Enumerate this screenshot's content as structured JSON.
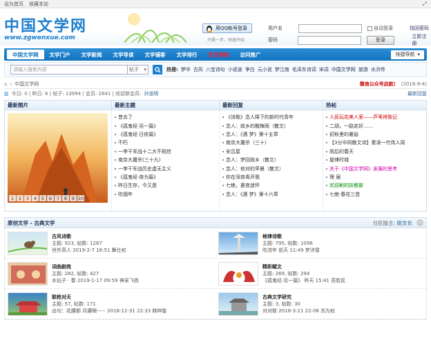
{
  "topbar": {
    "set_home": "设为首页",
    "favorite": "收藏本站"
  },
  "logo": {
    "cn": "中国文学网",
    "url": "www.zgwenxue.com"
  },
  "qq": {
    "login_label": "用QQ帐号登录",
    "sub": "只需一步，快速开始"
  },
  "login": {
    "user_label": "用户名",
    "user_value": "",
    "pass_label": "密码",
    "pass_value": "",
    "auto_login": "自动登录",
    "login_btn": "登录",
    "find_pwd": "找回密码",
    "register": "立即注册"
  },
  "nav": {
    "items": [
      "中国文学网",
      "文学门户",
      "文学新闻",
      "文学导读",
      "文学铺客",
      "文学排行",
      "官方网络",
      "访问推广"
    ],
    "quick_nav": "快捷导航"
  },
  "search": {
    "placeholder": "请输入搜索内容",
    "type": "帖子",
    "hot_label": "热搜:",
    "hot_words": [
      "梦中",
      "古风",
      "八宝诗句",
      "小说途",
      "李白",
      "元小说",
      "梦江南",
      "毛泽东诗词",
      "宋词",
      "中国文学网",
      "旅游",
      "水浒传"
    ]
  },
  "crumb": {
    "home": "中国文学网",
    "notice": "微信公众号启航！",
    "date": "(2016-9-4)"
  },
  "stats": {
    "text": "今日: 0 | 昨日: 6 | 帖子: 13994 | 会员: 2841 | 欢迎新会员:",
    "new_member": "孙道明",
    "latest": "最新回复"
  },
  "panel": {
    "heads": [
      "最新图片",
      "最新主题",
      "最新回复",
      "热帖"
    ],
    "slider_nums": [
      "1",
      "2",
      "3",
      "4",
      "5",
      "6",
      "7",
      "8",
      "9",
      "10"
    ],
    "new_topics": [
      "昔去了",
      "《孤鬼经·另一篇》",
      "《孤鬼经·日依篇》",
      "不朽",
      "一李干军战十二大不相信",
      "南京大屠杀(三十九)",
      "一李干军战历史虚无主义",
      "《孤鬼经·夜为篇》",
      "昨日生存，今又是",
      "吹烟年"
    ],
    "new_replies": [
      "《诗歌》念人降下的新时代青年",
      "念人：故乡的醒梅雨（散文）",
      "念人：《遇 梦》第十五章",
      "南京大屠杀（三十）",
      "安吕屋",
      "念人：梦回故乡（散文）",
      "念人：依对的早晨（散文）",
      "你在深夜毒开我",
      "七绝，夏夜迷怀",
      "念人：《遇 梦》第十六章"
    ],
    "hot": [
      {
        "t": "人民玩花美人室——芦苇将歌记",
        "c": "red"
      },
      {
        "t": "二胡，一路走好……",
        "c": ""
      },
      {
        "t": "初秋里的邂逅",
        "c": ""
      },
      {
        "t": "【3分中同散文诗】重读一代伟人周",
        "c": ""
      },
      {
        "t": "雨后的春天",
        "c": ""
      },
      {
        "t": "旋律时城",
        "c": ""
      },
      {
        "t": "关于《中国文学网》发展的思考",
        "c": "pink"
      },
      {
        "t": "理 届",
        "c": ""
      },
      {
        "t": "欢迎刷的扶都部",
        "c": "green"
      },
      {
        "t": "七绝·春花三首",
        "c": ""
      }
    ]
  },
  "section": {
    "title": "原创文学 - 古典文学",
    "moderator_label": "分区版主:",
    "moderator": "姚文长",
    "toggle": "−"
  },
  "forums": [
    {
      "name": "古风诗歌",
      "stats": "主题: 923, 帖数: 1287",
      "last": "世外高人 2019-2-7 16:51 舞仕权",
      "thumb": "bird"
    },
    {
      "name": "格律诗歌",
      "stats": "主题: 795, 帖数: 1096",
      "last": "吹流年 前天 11:49 梦涉雷",
      "thumb": "tower"
    },
    {
      "name": "词曲剧苑",
      "stats": "主题: 282, 帖数: 427",
      "last": "水仙子 · 春 2019-1-17 09:59 神采飞扬",
      "thumb": "scroll"
    },
    {
      "name": "精彩赋文",
      "stats": "主题: 269, 帖数: 294",
      "last": "《孤鬼经·另一篇》 昨天 15:41 吾胜民",
      "thumb": "dragon"
    },
    {
      "name": "联枪对天",
      "stats": "主题: 57, 帖数: 171",
      "last": "出句：花腰额 月腰眼----- 2018-12-31 22:33 韩梓能",
      "thumb": "palace"
    },
    {
      "name": "古典文学研究",
      "stats": "主题: 3, 帖数: 30",
      "last": "对对联 2018-3-21 22:08 苏为权",
      "thumb": "temple"
    }
  ],
  "colors": {
    "accent": "#1474bf",
    "red": "#cc0000"
  }
}
